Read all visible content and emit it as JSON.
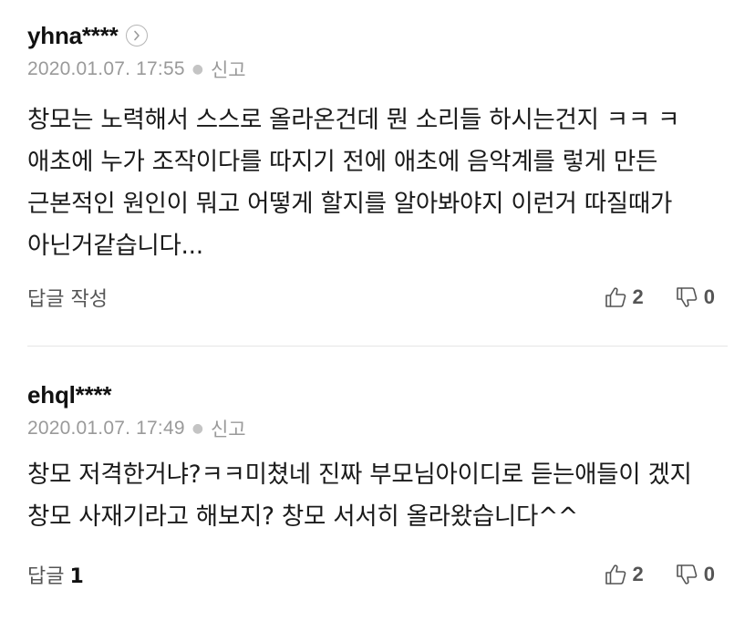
{
  "comments": [
    {
      "username": "yhna****",
      "date": "2020.01.07. 17:55",
      "report_label": "신고",
      "text": "창모는 노력해서 스스로 올라온건데 뭔 소리들 하시는건지 ㅋㅋ ㅋ 애초에 누가 조작이다를 따지기 전에 애초에 음악계를 렇게 만든 근본적인 원인이 뭐고 어떻게 할지를 알아봐야지 이런거 따질때가 아닌거같습니다...",
      "reply_label": "답글 작성",
      "reply_count": "",
      "likes": "2",
      "dislikes": "0"
    },
    {
      "username": "ehql****",
      "date": "2020.01.07. 17:49",
      "report_label": "신고",
      "text": "창모 저격한거냐?ㅋㅋ미쳤네 진짜 부모님아이디로 듣는애들이 겠지 창모 사재기라고 해보지? 창모 서서히 올라왔습니다^^",
      "reply_label": "답글",
      "reply_count": "1",
      "likes": "2",
      "dislikes": "0"
    }
  ],
  "icons": {
    "profile": "chevron-right-icon",
    "like": "thumbs-up-icon",
    "dislike": "thumbs-down-icon"
  },
  "colors": {
    "text": "#111111",
    "meta": "#9a9a9a",
    "icon": "#555555",
    "divider": "#e6e6e6"
  }
}
